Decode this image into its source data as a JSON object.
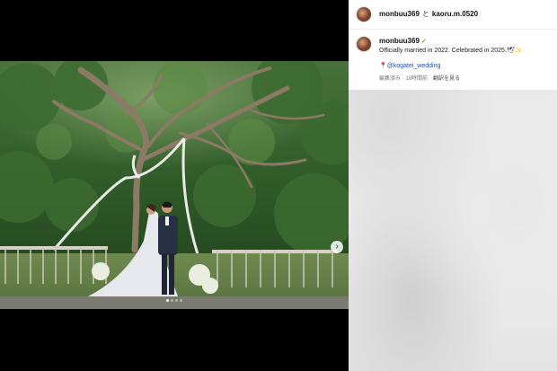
{
  "header": {
    "user1": "monbuu369",
    "joiner": "と",
    "user2": "kaoru.m.0520"
  },
  "post": {
    "username": "monbuu369",
    "verified_icon": "leaf-icon",
    "caption": "Officially married in 2022. Celebrated in 2025.🕊✨",
    "mention": "@kogatei_wedding",
    "pin_icon": "pin-icon",
    "edited_label": "編集済み",
    "time_ago": "16時間前",
    "translate_label": "翻訳を見る"
  },
  "media": {
    "next_icon": "chevron-right-icon",
    "carousel_total": 4,
    "carousel_index": 0
  },
  "colors": {
    "link": "#1a4ec9",
    "pin": "#e23b3b",
    "verified": "#6a9c3d"
  }
}
